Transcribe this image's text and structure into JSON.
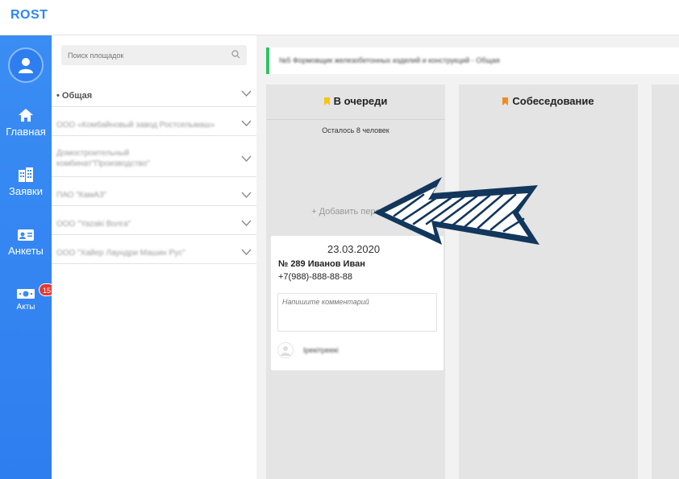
{
  "app": {
    "logo": "ROST"
  },
  "nav": {
    "items": [
      {
        "label": "Главная",
        "icon": "home-icon"
      },
      {
        "label": "Заявки",
        "icon": "buildings-icon"
      },
      {
        "label": "Анкеты",
        "icon": "id-card-icon"
      },
      {
        "label": "Акты",
        "icon": "money-icon",
        "badge": "15"
      }
    ]
  },
  "sidebar": {
    "search_placeholder": "Поиск площадок",
    "sites": [
      {
        "label": "• Общая"
      },
      {
        "label": "ООО «Комбайновый завод Ростсельмаш»"
      },
      {
        "label": "Домостроительный комбинат\"Производство\""
      },
      {
        "label": "ПАО \"КамАЗ\""
      },
      {
        "label": "ООО \"Yazaki Волга\""
      },
      {
        "label": "ООО \"Хайер Лаундри Машин Рус\""
      }
    ]
  },
  "main": {
    "banner": "№5 Формовщик железобетонных изделий и конструкций - Общая",
    "columns": [
      {
        "title": "В очереди",
        "bookmark_color": "#f5c518",
        "remaining": "Осталось 8 человек",
        "add_label": "+ Добавить персонал",
        "card": {
          "date": "23.03.2020",
          "title": "№ 289 Иванов Иван",
          "phone": "+7(988)-888-88-88",
          "comment_placeholder": "Напишите комментарий",
          "user": "Ірекітреекі"
        }
      },
      {
        "title": "Собеседование",
        "bookmark_color": "#f08c1a"
      }
    ]
  },
  "colors": {
    "brand": "#2d86f5",
    "nav": "#3a8df3",
    "accent_green": "#2ec463",
    "badge": "#e53935",
    "arrow": "#12365c"
  }
}
